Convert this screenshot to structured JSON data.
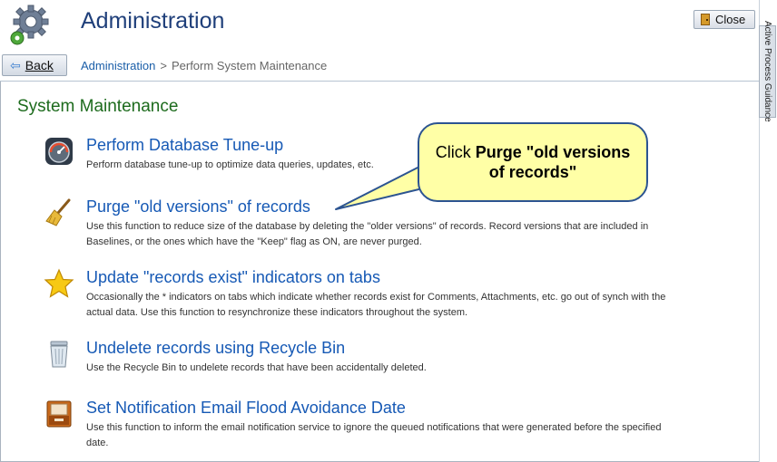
{
  "header": {
    "title": "Administration",
    "close_label": "Close",
    "back_label": "Back"
  },
  "breadcrumb": {
    "items": [
      "Administration",
      ">",
      "Perform System Maintenance"
    ]
  },
  "guidance_tab": "Active Process Guidance",
  "section_title": "System Maintenance",
  "items": [
    {
      "title": "Perform Database Tune-up",
      "desc": "Perform database tune-up to optimize data queries, updates, etc.",
      "icon": "gauge-icon"
    },
    {
      "title": "Purge \"old versions\" of records",
      "desc": "Use this function to reduce size of the database by deleting the \"older versions\" of records. Record versions that are included in Baselines, or the ones which have the \"Keep\" flag as ON, are never purged.",
      "icon": "broom-icon"
    },
    {
      "title": "Update \"records exist\" indicators on tabs",
      "desc": "Occasionally the * indicators on tabs which indicate whether records exist for Comments, Attachments, etc. go out of synch with the actual data. Use this function to resynchronize these indicators throughout the system.",
      "icon": "star-icon"
    },
    {
      "title": "Undelete records using Recycle Bin",
      "desc": "Use the Recycle Bin to undelete records that have been accidentally deleted.",
      "icon": "recycle-bin-icon"
    },
    {
      "title": "Set Notification Email Flood Avoidance Date",
      "desc": "Use this function to inform the email notification service to ignore the queued notifications that were generated before the specified date.",
      "icon": "inbox-tray-icon"
    }
  ],
  "callout": {
    "prefix": "Click ",
    "bold": "Purge \"old versions of records\""
  },
  "colors": {
    "title_blue": "#1f3f7a",
    "link_blue": "#1659b5",
    "section_green": "#1d6b1d",
    "callout_fill": "#ffffa6",
    "callout_border": "#2c5491"
  }
}
